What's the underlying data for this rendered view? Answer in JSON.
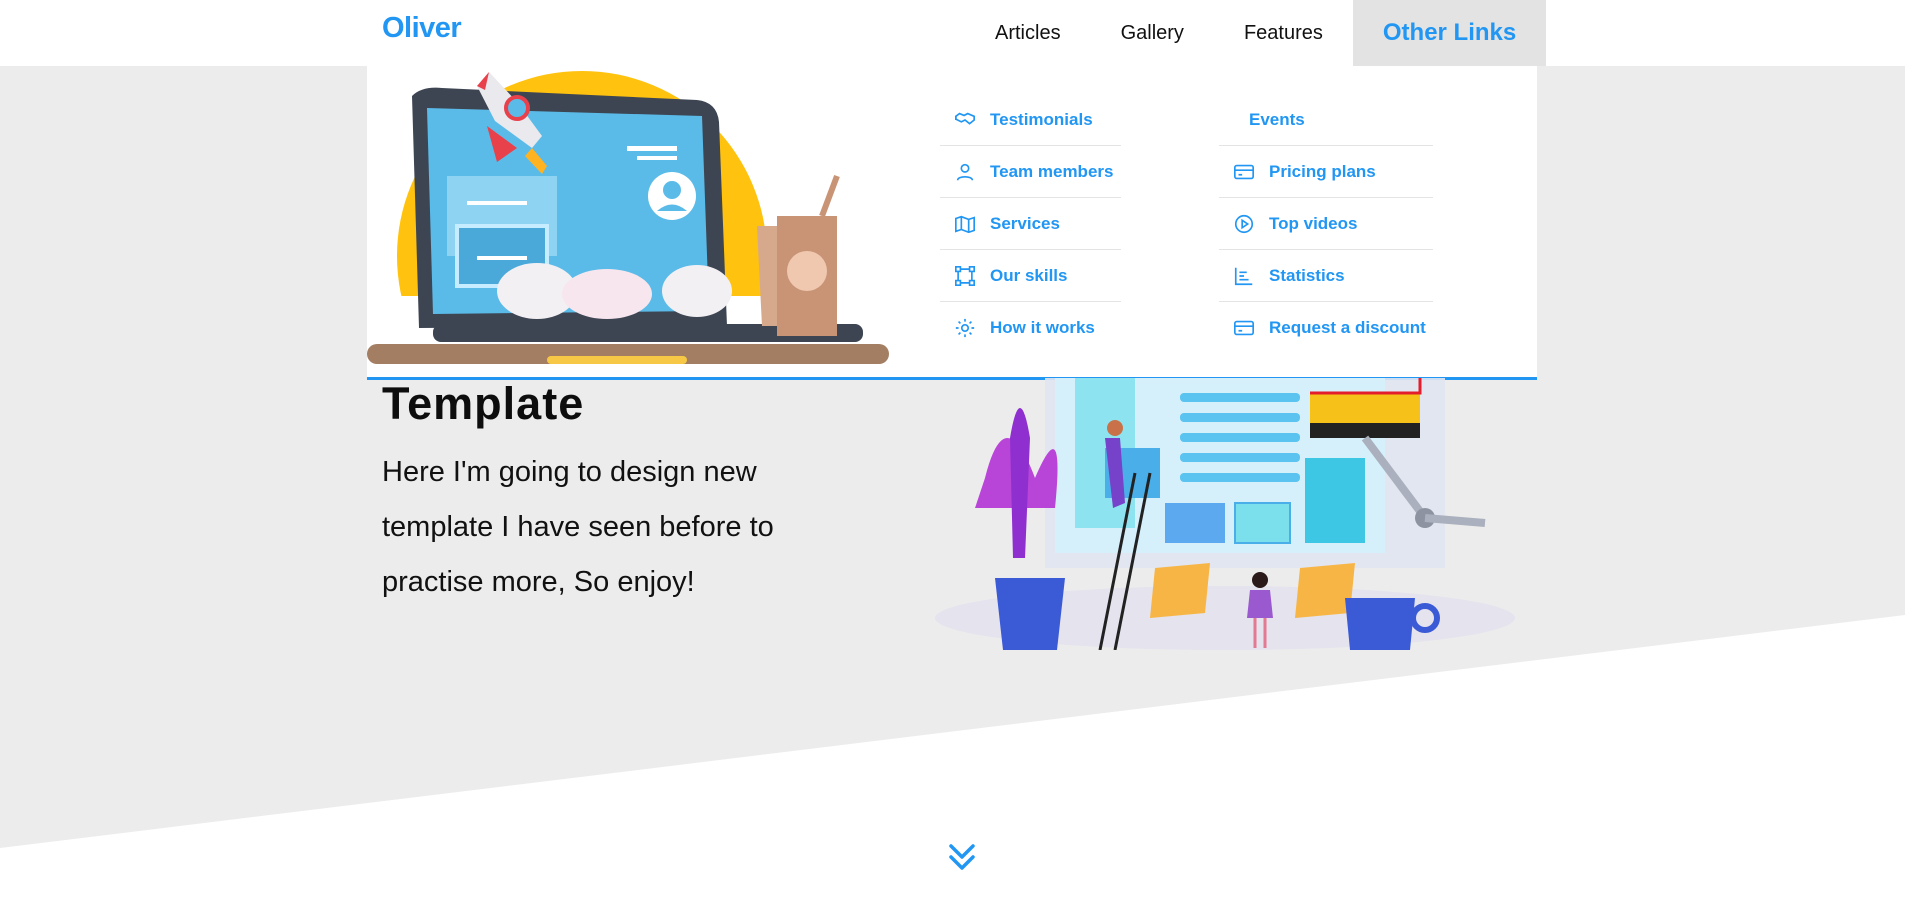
{
  "header": {
    "logo": "Oliver",
    "nav": [
      {
        "label": "Articles"
      },
      {
        "label": "Gallery"
      },
      {
        "label": "Features"
      },
      {
        "label": "Other Links"
      }
    ]
  },
  "mega_menu": {
    "column1": [
      {
        "label": "Testimonials",
        "icon": "handshake-icon"
      },
      {
        "label": "Team members",
        "icon": "user-icon"
      },
      {
        "label": "Services",
        "icon": "map-icon"
      },
      {
        "label": "Our skills",
        "icon": "vector-icon"
      },
      {
        "label": "How it works",
        "icon": "gear-icon"
      }
    ],
    "column2": [
      {
        "label": "Events"
      },
      {
        "label": "Pricing plans",
        "icon": "credit-card-icon"
      },
      {
        "label": "Top videos",
        "icon": "play-circle-icon"
      },
      {
        "label": "Statistics",
        "icon": "chart-bar-icon"
      },
      {
        "label": "Request a discount",
        "icon": "credit-card-icon"
      }
    ]
  },
  "hero": {
    "title": "Template",
    "text": "Here I'm going to design new template I have seen before to practise more, So enjoy!"
  },
  "colors": {
    "accent": "#2196f3",
    "hero_bg": "#ececec"
  }
}
